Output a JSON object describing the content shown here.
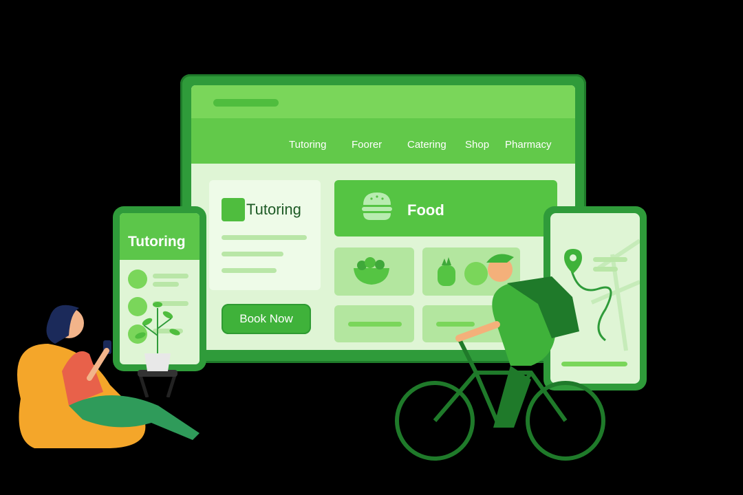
{
  "desktop": {
    "nav": [
      "Tutoring",
      "Foorer",
      "Catering",
      "Shop",
      "Pharmacy"
    ],
    "tutoring_title": "Tutoring",
    "book_now": "Book Now",
    "food_title": "Food"
  },
  "mobile_left": {
    "title": "Tutoring"
  },
  "colors": {
    "primary": "#3fb23a",
    "light": "#dff5d5",
    "dark": "#1f7a2a",
    "accent_orange": "#f4a62a"
  },
  "icons": [
    "burger-icon",
    "salad-icon",
    "location-pin-icon",
    "plant",
    "delivery-bag-icon"
  ]
}
